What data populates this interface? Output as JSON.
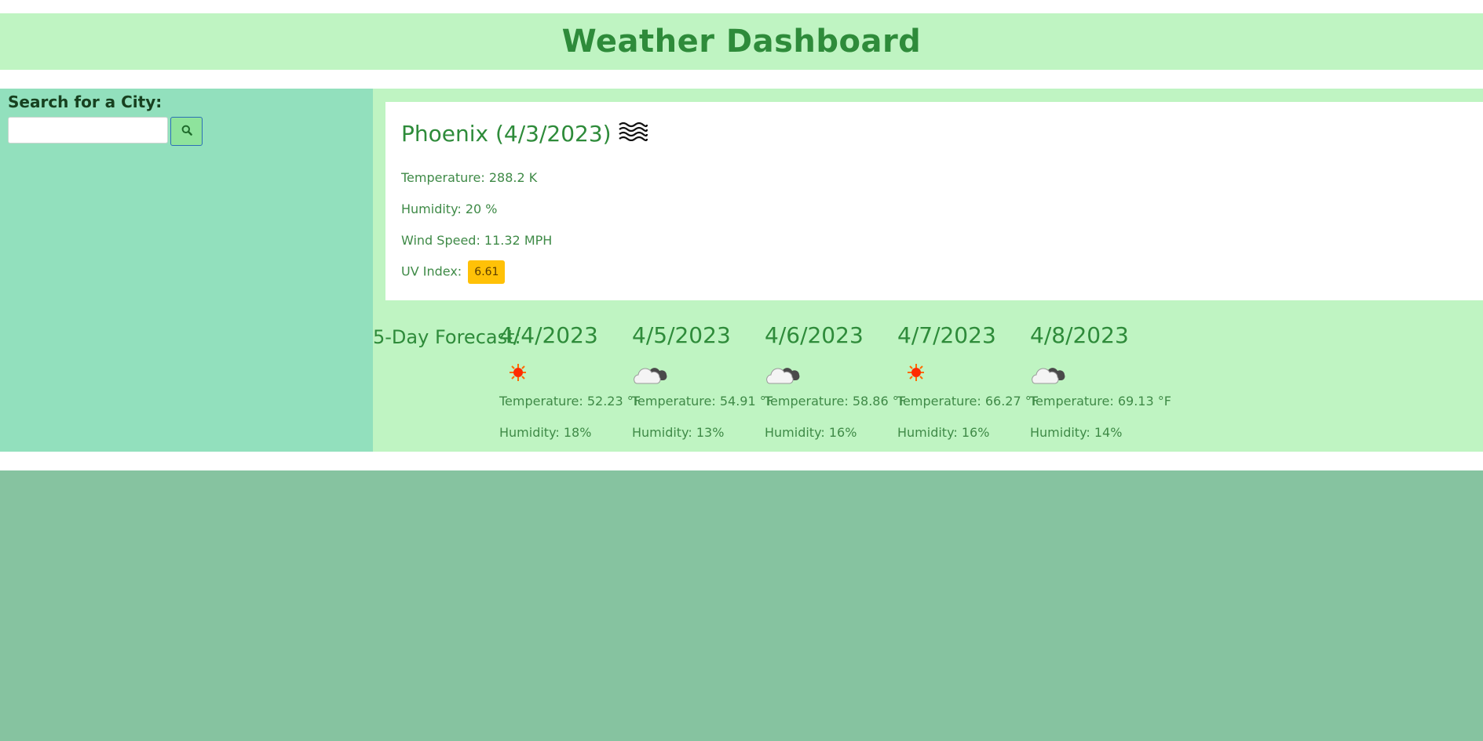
{
  "header": {
    "title": "Weather Dashboard"
  },
  "sidebar": {
    "search_label": "Search for a City:",
    "search_value": "",
    "search_button_icon": "search-icon"
  },
  "current": {
    "title": "Phoenix (4/3/2023)",
    "icon": "mist-icon",
    "temperature": "Temperature: 288.2 K",
    "humidity": "Humidity: 20 %",
    "wind": "Wind Speed: 11.32 MPH",
    "uv_label": "UV Index:",
    "uv_value": "6.61",
    "uv_color": "#ffc107"
  },
  "forecast": {
    "title": "5-Day Forecast:",
    "days": [
      {
        "date": "4/4/2023",
        "icon": "sun-icon",
        "temp": "Temperature: 52.23 °F",
        "humidity": "Humidity: 18%"
      },
      {
        "date": "4/5/2023",
        "icon": "cloud-icon",
        "temp": "Temperature: 54.91 °F",
        "humidity": "Humidity: 13%"
      },
      {
        "date": "4/6/2023",
        "icon": "cloud-icon",
        "temp": "Temperature: 58.86 °F",
        "humidity": "Humidity: 16%"
      },
      {
        "date": "4/7/2023",
        "icon": "sun-icon",
        "temp": "Temperature: 66.27 °F",
        "humidity": "Humidity: 16%"
      },
      {
        "date": "4/8/2023",
        "icon": "cloud-icon",
        "temp": "Temperature: 69.13 °F",
        "humidity": "Humidity: 14%"
      }
    ]
  },
  "colors": {
    "header_bg": "#bff4c2",
    "sidebar_bg": "#92e0bd",
    "main_bg": "#bff4c2",
    "footer_bg": "#86c3a0",
    "text_green": "#2e8b3a"
  }
}
